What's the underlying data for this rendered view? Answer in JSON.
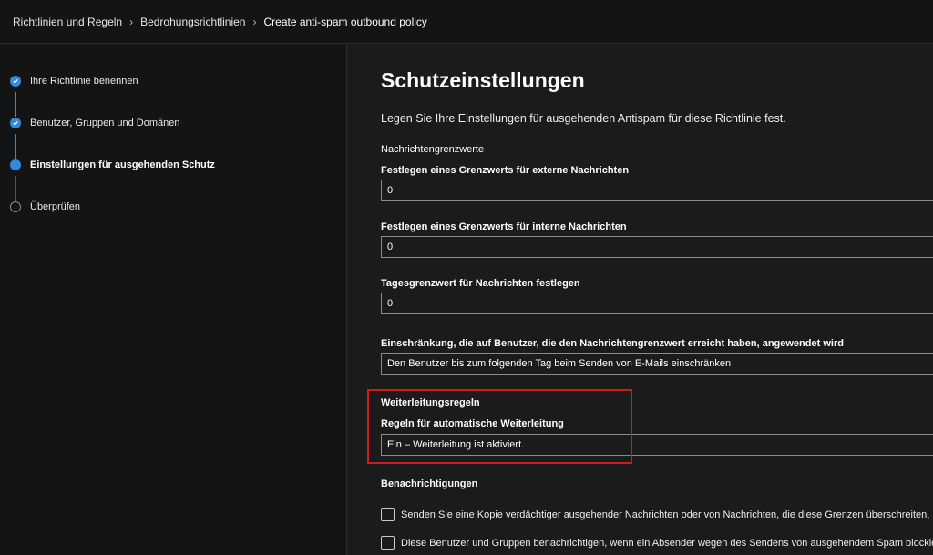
{
  "breadcrumb": {
    "items": [
      "Richtlinien und Regeln",
      "Bedrohungsrichtlinien",
      "Create anti-spam outbound policy"
    ]
  },
  "wizard": {
    "steps": [
      {
        "label": "Ihre Richtlinie benennen",
        "state": "done"
      },
      {
        "label": "Benutzer, Gruppen und Domänen",
        "state": "done"
      },
      {
        "label": "Einstellungen für ausgehenden Schutz",
        "state": "current"
      },
      {
        "label": "Überprüfen",
        "state": "todo"
      }
    ]
  },
  "main": {
    "title": "Schutzeinstellungen",
    "subtitle": "Legen Sie Ihre Einstellungen für ausgehenden Antispam für diese Richtlinie fest.",
    "limits_section": "Nachrichtengrenzwerte",
    "external_label": "Festlegen eines Grenzwerts für externe Nachrichten",
    "external_value": "0",
    "internal_label": "Festlegen eines Grenzwerts für interne Nachrichten",
    "internal_value": "0",
    "daily_label": "Tagesgrenzwert für Nachrichten festlegen",
    "daily_value": "0",
    "restriction_label": "Einschränkung, die auf Benutzer, die den Nachrichtengrenzwert erreicht haben, angewendet wird",
    "restriction_value": "Den Benutzer bis zum folgenden Tag beim Senden von E-Mails einschränken",
    "forwarding_section": "Weiterleitungsregeln",
    "forwarding_label": "Regeln für automatische Weiterleitung",
    "forwarding_value": "Ein – Weiterleitung ist aktiviert.",
    "notifications_section": "Benachrichtigungen",
    "notify_copy": "Senden Sie eine Kopie verdächtiger ausgehender Nachrichten oder von Nachrichten, die diese Grenzen überschreiten, an dies",
    "notify_blocked": "Diese Benutzer und Gruppen benachrichtigen, wenn ein Absender wegen des Sendens von ausgehendem Spam blockiert wird"
  },
  "colors": {
    "accent": "#2f8bdc",
    "highlight_border": "#d21c1c"
  }
}
